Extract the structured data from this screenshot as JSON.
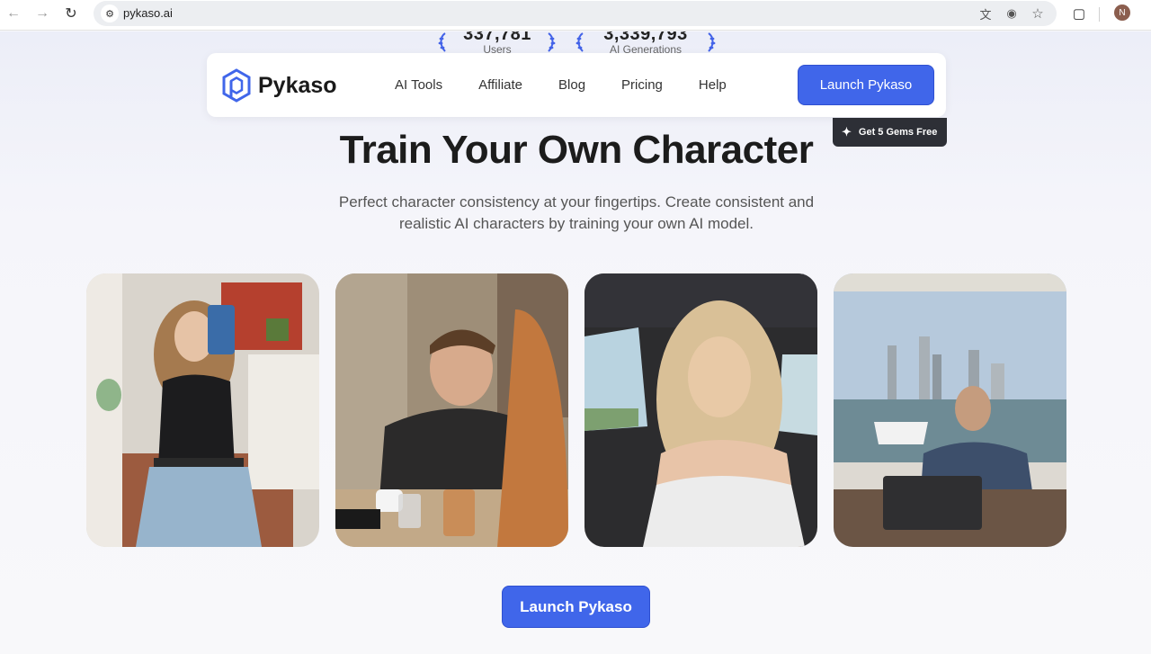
{
  "browser": {
    "url": "pykaso.ai",
    "profile_initial": "N"
  },
  "stats": [
    {
      "value": "337,781",
      "label": "Users"
    },
    {
      "value": "3,339,793",
      "label": "AI Generations"
    }
  ],
  "header": {
    "brand": "Pykaso",
    "nav": [
      "AI Tools",
      "Affiliate",
      "Blog",
      "Pricing",
      "Help"
    ],
    "launch_label": "Launch Pykaso",
    "gems_label": "Get 5 Gems Free"
  },
  "hero": {
    "title": "Train Your Own Character",
    "subtitle": "Perfect character consistency at your fingertips. Create consistent and realistic AI characters by training your own AI model."
  },
  "cta": {
    "launch_label": "Launch Pykaso"
  },
  "colors": {
    "accent": "#4066ea",
    "badge_bg": "#2d2f36"
  }
}
